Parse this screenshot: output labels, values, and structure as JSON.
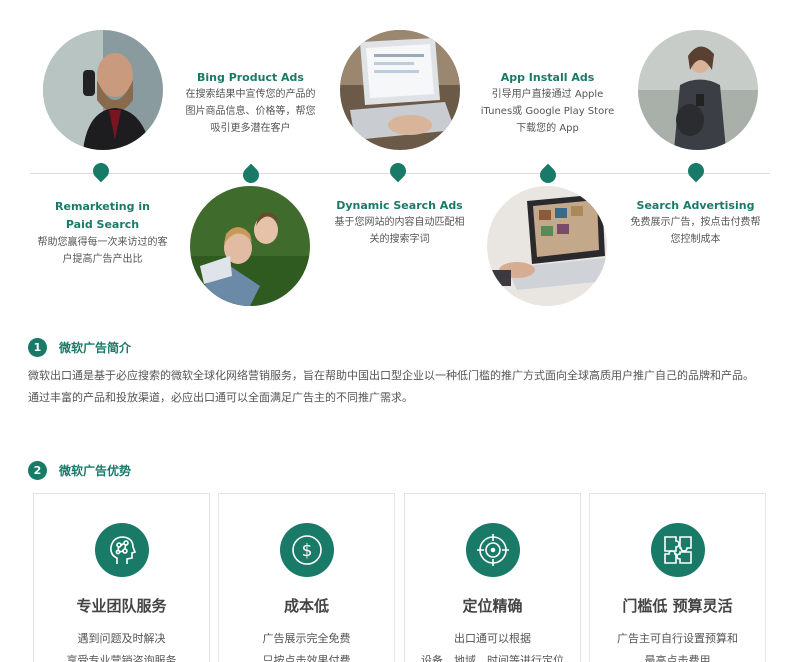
{
  "timeline": {
    "items": [
      {
        "title": "Bing Product Ads",
        "desc": [
          "在搜索结果中宣传您的产品的",
          "图片商品信息、价格等，帮您",
          "吸引更多潜在客户"
        ]
      },
      {
        "title": "App Install Ads",
        "desc": [
          "引导用户直接通过 Apple",
          "iTunes或 Google Play Store",
          "下载您的 App"
        ]
      },
      {
        "title": "Remarketing in Paid Search",
        "desc": [
          "帮助您赢得每一次来访过的客",
          "户提高广告产出比"
        ]
      },
      {
        "title": "Dynamic Search Ads",
        "desc": [
          "基于您网站的内容自动匹配相",
          "关的搜索字词"
        ]
      },
      {
        "title": "Search Advertising",
        "desc": [
          "免费展示广告，按点击付费帮",
          "您控制成本"
        ]
      }
    ]
  },
  "intro": {
    "number": "1",
    "title": "微软广告简介",
    "paragraph1": "微软出口通是基于必应搜索的微软全球化网络营销服务，旨在帮助中国出口型企业以一种低门槛的推广方式面向全球高质用户推广自己的品牌和产品。",
    "paragraph2": "通过丰富的产品和投放渠道，必应出口通可以全面满足广告主的不同推广需求。"
  },
  "advantages": {
    "number": "2",
    "title": "微软广告优势",
    "cards": [
      {
        "icon": "head-network-icon",
        "title": "专业团队服务",
        "lines": [
          "遇到问题及时解决",
          "享受专业营销咨询服务"
        ]
      },
      {
        "icon": "dollar-icon",
        "title": "成本低",
        "lines": [
          "广告展示完全免费",
          "只按点击效果付费"
        ]
      },
      {
        "icon": "target-icon",
        "title": "定位精确",
        "lines": [
          "出口通可以根据",
          "设备、地域、时间等进行定位"
        ]
      },
      {
        "icon": "puzzle-icon",
        "title": "门槛低 预算灵活",
        "lines": [
          "广告主可自行设置预算和",
          "最高点击费用"
        ]
      }
    ]
  },
  "colors": {
    "accent": "#1a7a68",
    "text": "#555555"
  }
}
